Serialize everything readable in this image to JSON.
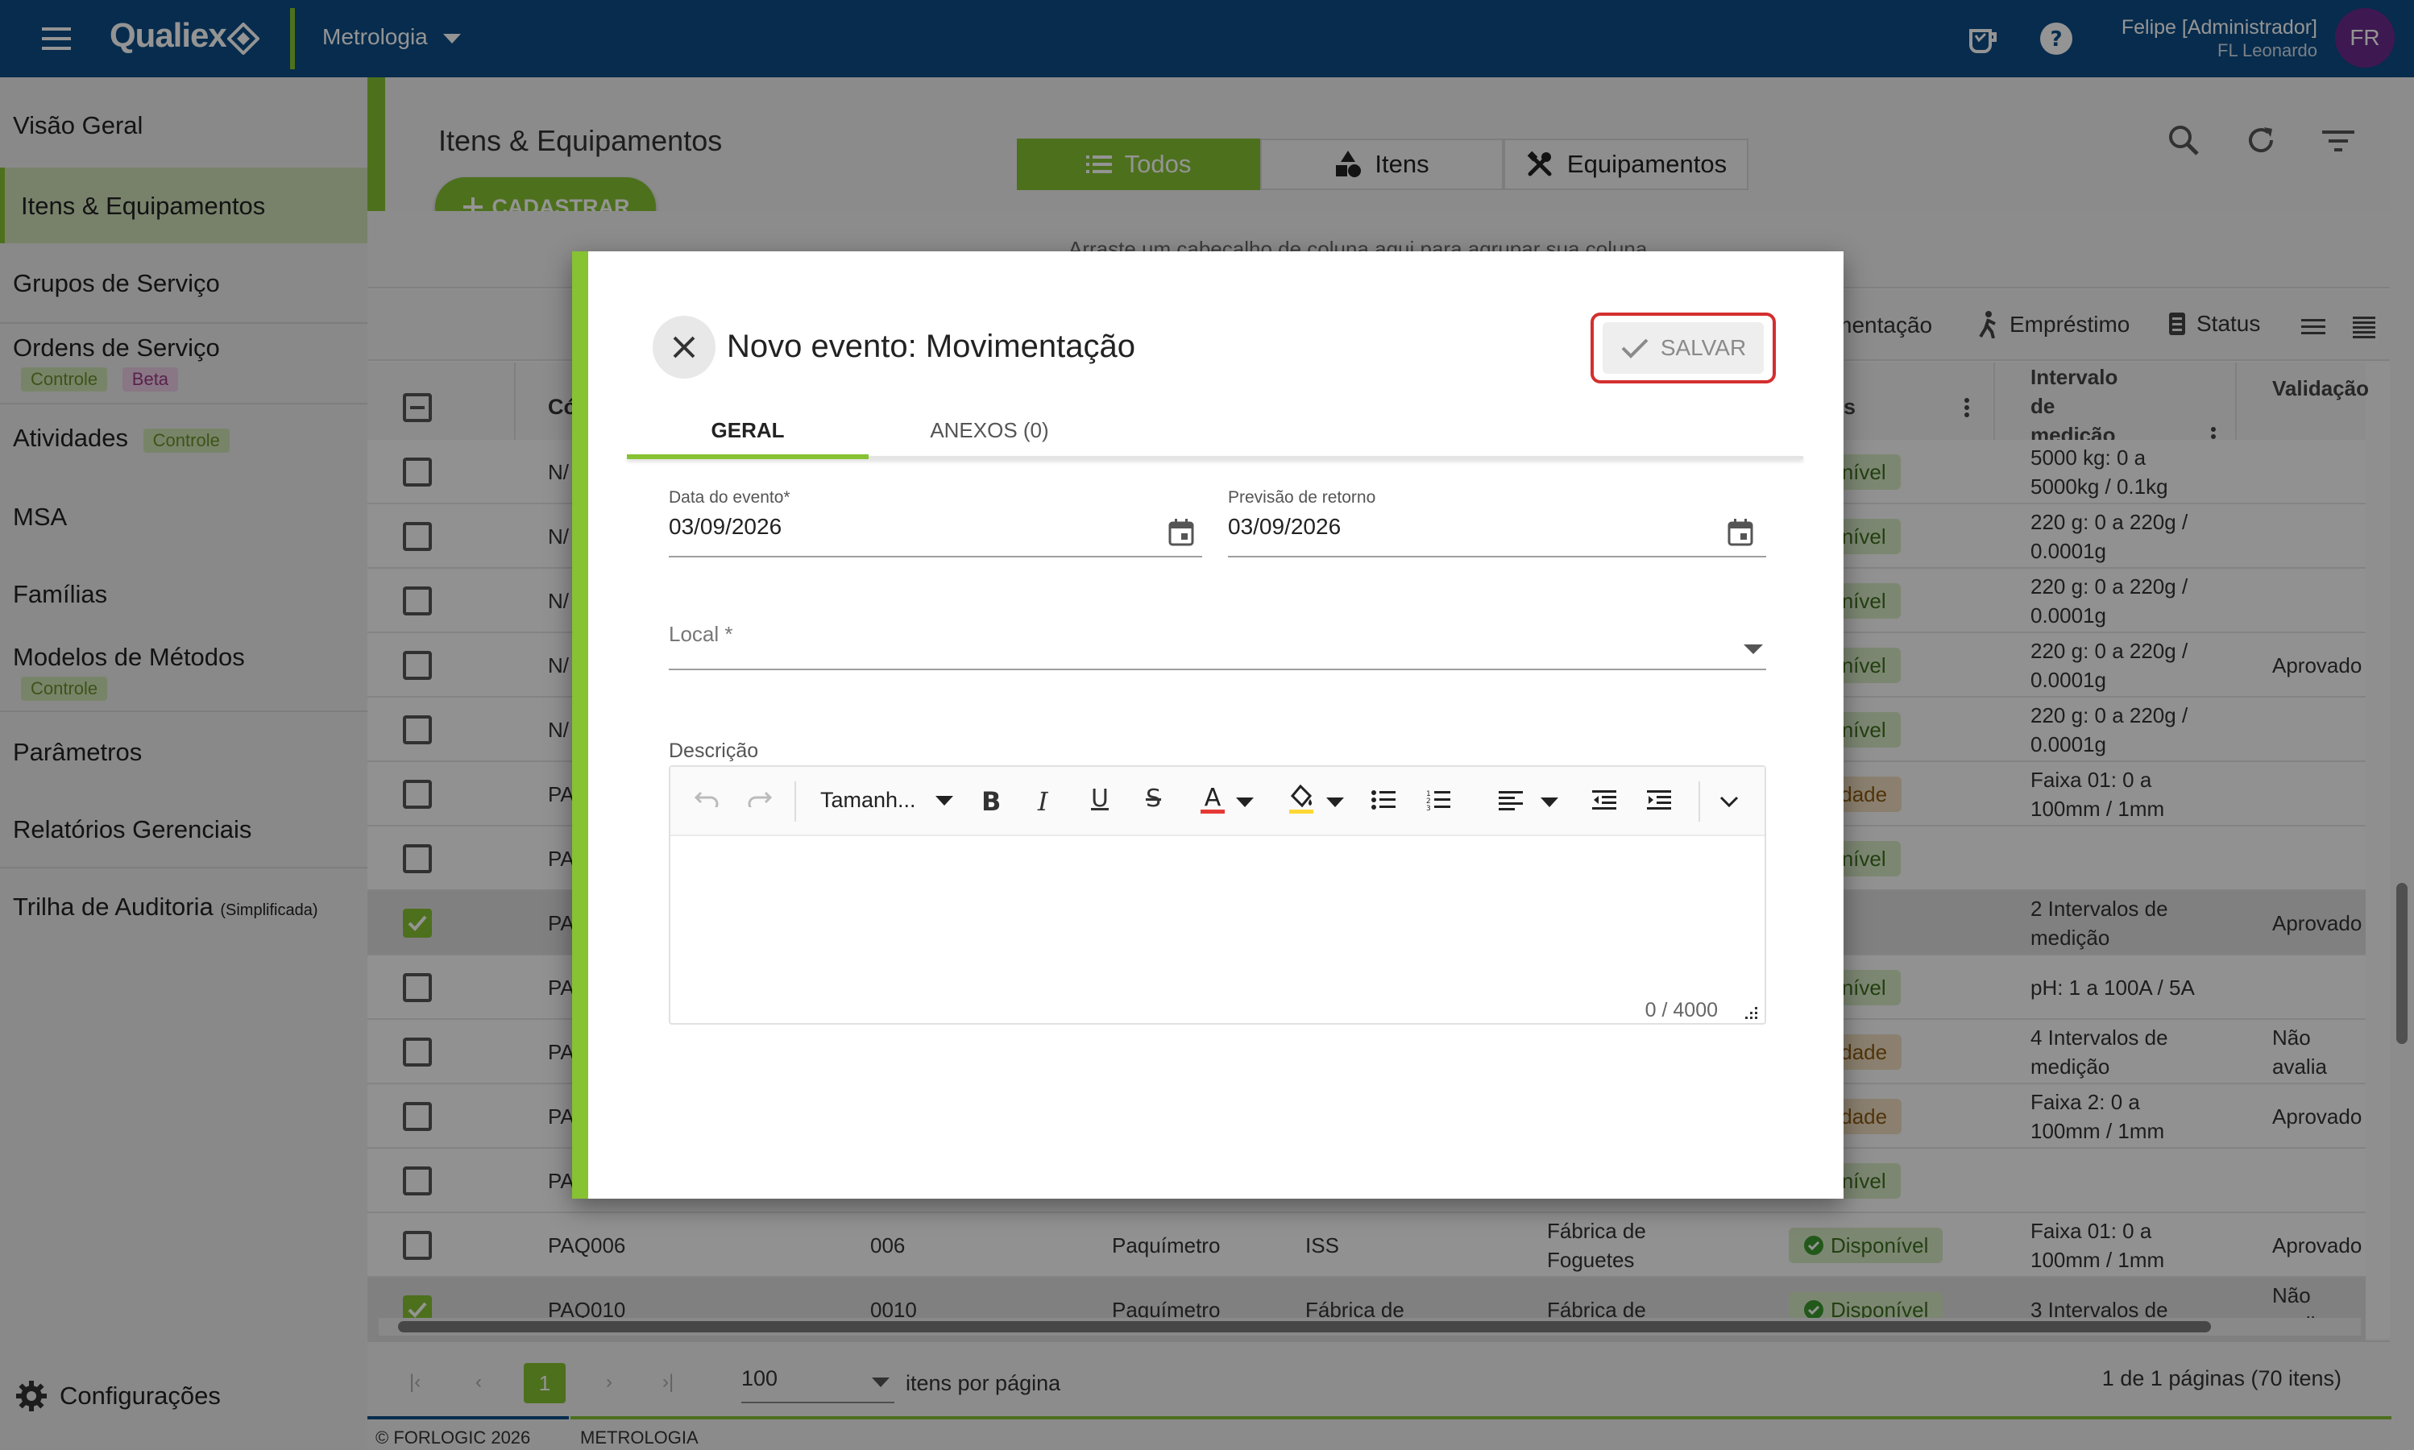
{
  "topbar": {
    "logo": "Qualiex",
    "module": "Metrologia",
    "user_name": "Felipe [Administrador]",
    "user_org": "FL Leonardo",
    "avatar_initials": "FR"
  },
  "sidebar": {
    "items": [
      {
        "label": "Visão Geral"
      },
      {
        "label": "Itens & Equipamentos"
      },
      {
        "label": "Grupos de Serviço"
      },
      {
        "label": "Ordens de Serviço",
        "badges": [
          "Controle",
          "Beta"
        ]
      },
      {
        "label": "Atividades",
        "badges": [
          "Controle"
        ]
      },
      {
        "label": "MSA"
      },
      {
        "label": "Famílias"
      },
      {
        "label": "Modelos de Métodos",
        "badges": [
          "Controle"
        ]
      },
      {
        "label": "Parâmetros"
      },
      {
        "label": "Relatórios Gerenciais"
      },
      {
        "label": "Trilha de Auditoria",
        "suffix": "(Simplificada)"
      }
    ],
    "settings_label": "Configurações"
  },
  "main": {
    "title": "Itens & Equipamentos",
    "add_button": "CADASTRAR",
    "segments": [
      "Todos",
      "Itens",
      "Equipamentos"
    ],
    "group_hint": "Arraste um cabeçalho de coluna aqui para agrupar sua coluna",
    "toolbar": {
      "movement": "Movimentação",
      "loan": "Empréstimo",
      "status": "Status"
    },
    "col_code": "Có",
    "col_s": "s",
    "col_interval": "Intervalo de medição",
    "col_validation": "Validação última ca"
  },
  "grid_rows": [
    {
      "code": "N/",
      "status": "isponível",
      "st": "ok",
      "interval": "5000 kg: 0 a 5000kg / 0.1kg",
      "valid": ""
    },
    {
      "code": "N/",
      "status": "isponível",
      "st": "ok",
      "interval": "220 g: 0 a 220g / 0.0001g",
      "valid": ""
    },
    {
      "code": "N/",
      "status": "isponível",
      "st": "ok",
      "interval": "220 g: 0 a 220g / 0.0001g",
      "valid": ""
    },
    {
      "code": "N/",
      "status": "isponível",
      "st": "ok",
      "interval": "220 g: 0 a 220g / 0.0001g",
      "valid": "Aprovado"
    },
    {
      "code": "N/",
      "status": "isponível",
      "st": "ok",
      "interval": "220 g: 0 a 220g / 0.0001g",
      "valid": ""
    },
    {
      "code": "PA",
      "status": "atividade",
      "st": "warn",
      "interval": "Faixa 01: 0 a 100mm / 1mm",
      "valid": ""
    },
    {
      "code": "PA",
      "status": "isponível",
      "st": "ok",
      "interval": "",
      "valid": ""
    },
    {
      "code": "PA",
      "status": "vo",
      "st": "grey",
      "interval": "2 Intervalos de medição",
      "valid": "Aprovado",
      "selected": true
    },
    {
      "code": "PA",
      "status": "isponível",
      "st": "ok",
      "interval": "pH: 1 a 100A / 5A",
      "valid": ""
    },
    {
      "code": "PA",
      "status": "atividade",
      "st": "warn",
      "interval": "4 Intervalos de medição",
      "valid": "Não avalia"
    },
    {
      "code": "PA",
      "status": "atividade",
      "st": "warn",
      "interval": "Faixa 2: 0 a 100mm / 1mm",
      "valid": "Aprovado"
    },
    {
      "code": "PA",
      "status": "isponível",
      "st": "ok",
      "interval": "",
      "valid": ""
    },
    {
      "code": "PAQ006",
      "num": "006",
      "type": "Paquímetro",
      "loc1": "ISS",
      "loc2": "Fábrica de Foguetes",
      "status": "Disponível",
      "st": "ok",
      "interval": "Faixa 01: 0 a 100mm / 1mm",
      "valid": "Aprovado"
    },
    {
      "code": "PAQ010",
      "num": "0010",
      "type": "Paquímetro",
      "loc1": "Fábrica de",
      "loc2": "Fábrica de",
      "status": "Disponível",
      "st": "ok",
      "interval": "3 Intervalos de",
      "valid": "Não avalia",
      "selected": true
    }
  ],
  "pager": {
    "page": "1",
    "per_page": "100",
    "per_page_label": "itens por página",
    "summary": "1 de 1 páginas (70 itens)"
  },
  "footer": {
    "copyright": "© FORLOGIC 2026",
    "module": "METROLOGIA"
  },
  "modal": {
    "title": "Novo evento: Movimentação",
    "save_label": "SALVAR",
    "tabs": [
      "GERAL",
      "ANEXOS (0)"
    ],
    "event_date_label": "Data do evento*",
    "event_date": "03/09/2026",
    "return_date_label": "Previsão de retorno",
    "return_date": "03/09/2026",
    "local_label": "Local *",
    "description_label": "Descrição",
    "font_size_label": "Tamanh...",
    "char_count": "0 / 4000"
  },
  "colors": {
    "brand": "#0d4c85",
    "accent": "#86c232",
    "danger": "#d32f2f"
  }
}
